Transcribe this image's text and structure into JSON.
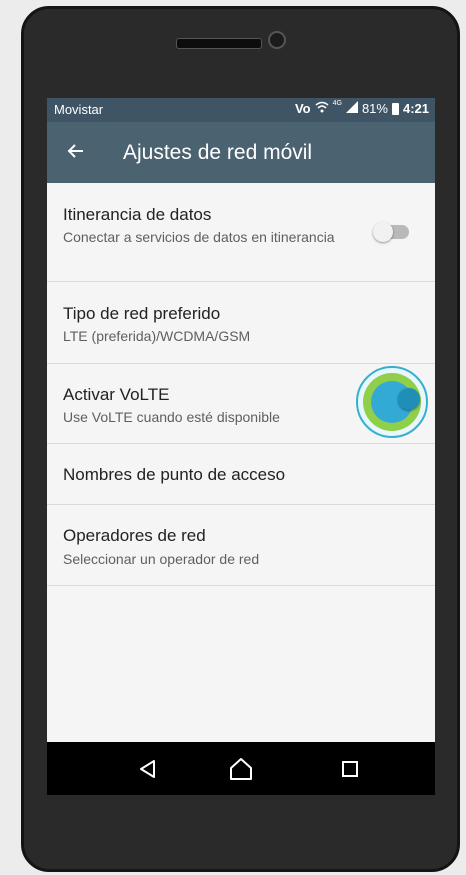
{
  "status_bar": {
    "carrier": "Movistar",
    "volte": "Vo",
    "network": "4G",
    "battery": "81%",
    "time": "4:21"
  },
  "app_bar": {
    "title": "Ajustes de red móvil",
    "back_icon": "arrow-back-icon"
  },
  "settings": [
    {
      "title": "Itinerancia de datos",
      "subtitle": "Conectar a servicios de datos en itinerancia",
      "toggle": false
    },
    {
      "title": "Tipo de red preferido",
      "subtitle": "LTE (preferida)/WCDMA/GSM"
    },
    {
      "title": "Activar VoLTE",
      "subtitle": "Use VoLTE cuando esté disponible",
      "toggle": true
    },
    {
      "title": "Nombres de punto de acceso"
    },
    {
      "title": "Operadores de red",
      "subtitle": "Seleccionar un operador de red"
    }
  ],
  "nav_bar": [
    "back-triangle-icon",
    "home-icon",
    "recents-icon"
  ],
  "colors": {
    "app_bar": "#4b6271",
    "status_bar": "#3f5565",
    "toggle_on": "#33a9d6",
    "touch_highlight": "#8fcf4a"
  }
}
